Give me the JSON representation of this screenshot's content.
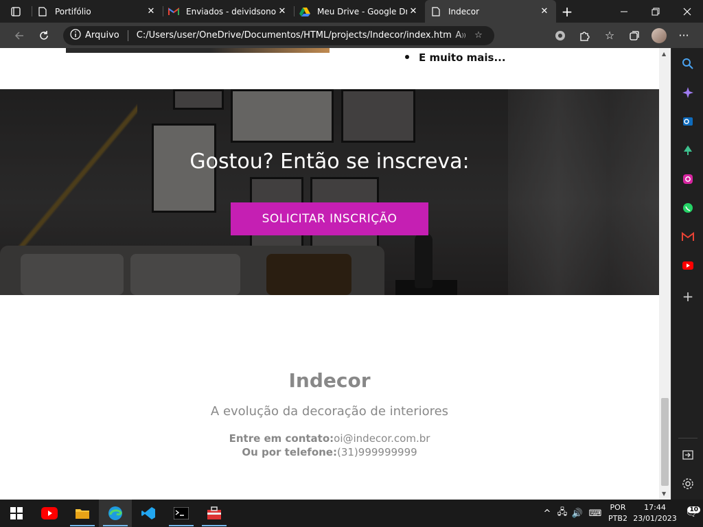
{
  "browser": {
    "tabs": [
      {
        "title": "Portifólio",
        "icon": "page-icon",
        "active": false
      },
      {
        "title": "Enviados - deividsonorr",
        "icon": "gmail-icon",
        "active": false
      },
      {
        "title": "Meu Drive - Google Driv",
        "icon": "google-drive-icon",
        "active": false
      },
      {
        "title": "Indecor",
        "icon": "page-icon",
        "active": true
      }
    ],
    "address": {
      "label": "Arquivo",
      "url": "C:/Users/user/OneDrive/Documentos/HTML/projects/Indecor/index.html"
    }
  },
  "page": {
    "list_item_last": "E muito mais...",
    "hero": {
      "title": "Gostou? Então se inscreva:",
      "cta_label": "SOLICITAR INSCRIÇÃO",
      "cta_color": "#c51fb3"
    },
    "footer": {
      "brand": "Indecor",
      "tagline": "A evolução da decoração de interiores",
      "contact_label": "Entre em contato:",
      "contact_value": "oi@indecor.com.br",
      "phone_label": "Ou por telefone:",
      "phone_value": "(31)999999999"
    }
  },
  "taskbar": {
    "language": "POR",
    "keyboard": "PTB2",
    "time": "17:44",
    "date": "23/01/2023",
    "notification_count": "10"
  }
}
